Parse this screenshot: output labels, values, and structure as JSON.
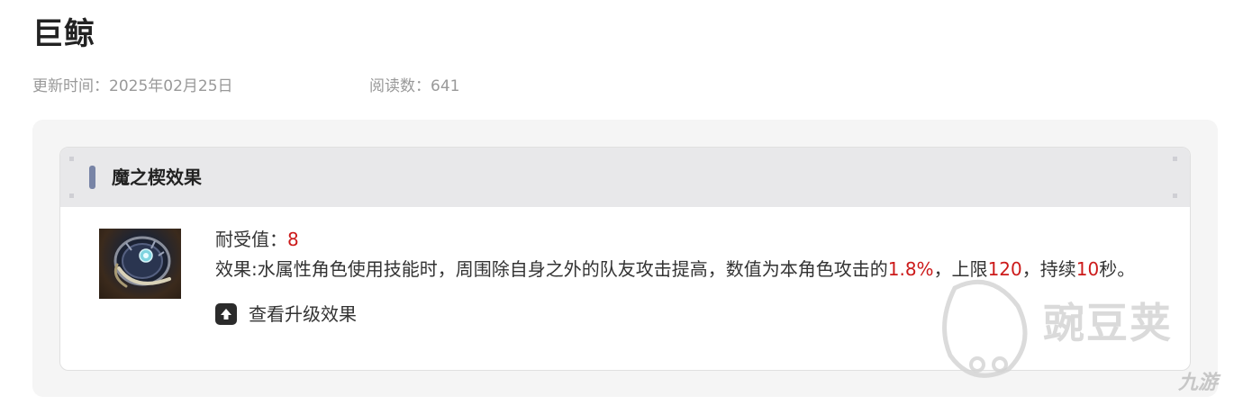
{
  "page": {
    "title": "巨鲸",
    "update_time": "更新时间：2025年02月25日",
    "read_count": "阅读数：641"
  },
  "card": {
    "title": "魔之楔效果",
    "durability_label": "耐受值：",
    "durability_value": "8",
    "effect": {
      "prefix": "效果:水属性角色使用技能时，周围除自身之外的队友攻击提高，数值为本角色攻击的",
      "percent": "1.8%",
      "mid1": "，上限",
      "limit": "120",
      "mid2": "，持续",
      "duration": "10",
      "suffix": "秒。"
    },
    "upgrade_label": "查看升级效果",
    "image_icon": "demon-wedge-image"
  },
  "watermark": {
    "brand": "豌豆荚",
    "brand2": "九游"
  },
  "colors": {
    "highlight": "#cc1a1a",
    "header_bar": "#7884a6",
    "header_bg": "#e8e8ea",
    "panel_bg": "#f5f5f5"
  }
}
